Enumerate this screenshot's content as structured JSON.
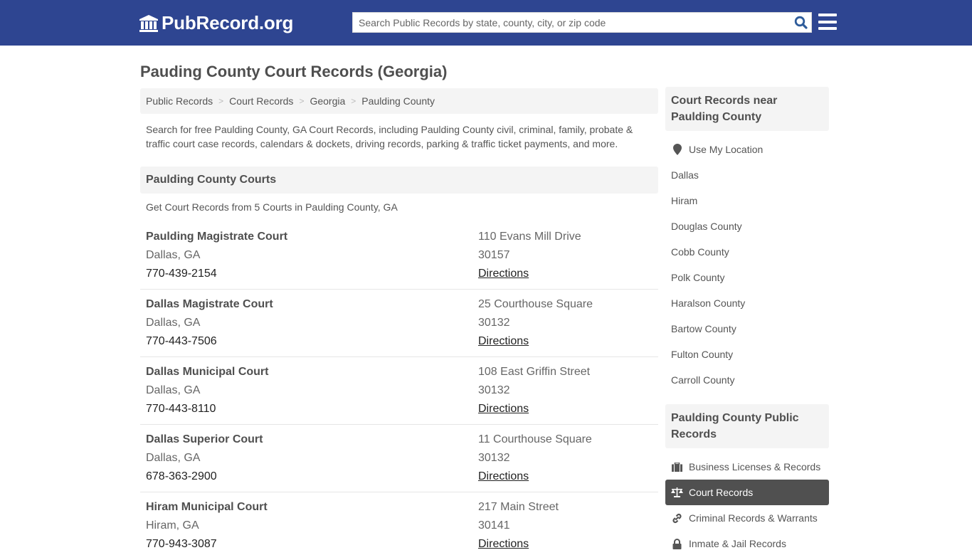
{
  "header": {
    "logo_text": "PubRecord.org",
    "search_placeholder": "Search Public Records by state, county, city, or zip code",
    "brand_color": "#2e4591"
  },
  "page": {
    "title": "Pauding County Court Records (Georgia)"
  },
  "breadcrumb": [
    {
      "label": "Public Records"
    },
    {
      "label": "Court Records"
    },
    {
      "label": "Georgia"
    },
    {
      "label": "Paulding County"
    }
  ],
  "intro": "Search for free Paulding County, GA Court Records, including Paulding County civil, criminal, family, probate & traffic court case records, calendars & dockets, driving records, parking & traffic ticket payments, and more.",
  "courts_section": {
    "heading": "Paulding County Courts",
    "subheading": "Get Court Records from 5 Courts in Paulding County, GA",
    "courts": [
      {
        "name": "Paulding Magistrate Court",
        "city": "Dallas, GA",
        "phone": "770-439-2154",
        "address": "110 Evans Mill Drive",
        "zip": "30157",
        "directions": "Directions"
      },
      {
        "name": "Dallas Magistrate Court",
        "city": "Dallas, GA",
        "phone": "770-443-7506",
        "address": "25 Courthouse Square",
        "zip": "30132",
        "directions": "Directions"
      },
      {
        "name": "Dallas Municipal Court",
        "city": "Dallas, GA",
        "phone": "770-443-8110",
        "address": "108 East Griffin Street",
        "zip": "30132",
        "directions": "Directions"
      },
      {
        "name": "Dallas Superior Court",
        "city": "Dallas, GA",
        "phone": "678-363-2900",
        "address": "11 Courthouse Square",
        "zip": "30132",
        "directions": "Directions"
      },
      {
        "name": "Hiram Municipal Court",
        "city": "Hiram, GA",
        "phone": "770-943-3087",
        "address": "217 Main Street",
        "zip": "30141",
        "directions": "Directions"
      }
    ]
  },
  "sidebar": {
    "nearby": {
      "heading": "Court Records near Paulding County",
      "use_location": "Use My Location",
      "items": [
        "Dallas",
        "Hiram",
        "Douglas County",
        "Cobb County",
        "Polk County",
        "Haralson County",
        "Bartow County",
        "Fulton County",
        "Carroll County"
      ]
    },
    "public_records": {
      "heading": "Paulding County Public Records",
      "items": [
        {
          "label": "Business Licenses & Records",
          "icon": "briefcase-icon",
          "active": false
        },
        {
          "label": "Court Records",
          "icon": "scale-icon",
          "active": true
        },
        {
          "label": "Criminal Records & Warrants",
          "icon": "link-icon",
          "active": false
        },
        {
          "label": "Inmate & Jail Records",
          "icon": "lock-icon",
          "active": false
        }
      ]
    }
  }
}
